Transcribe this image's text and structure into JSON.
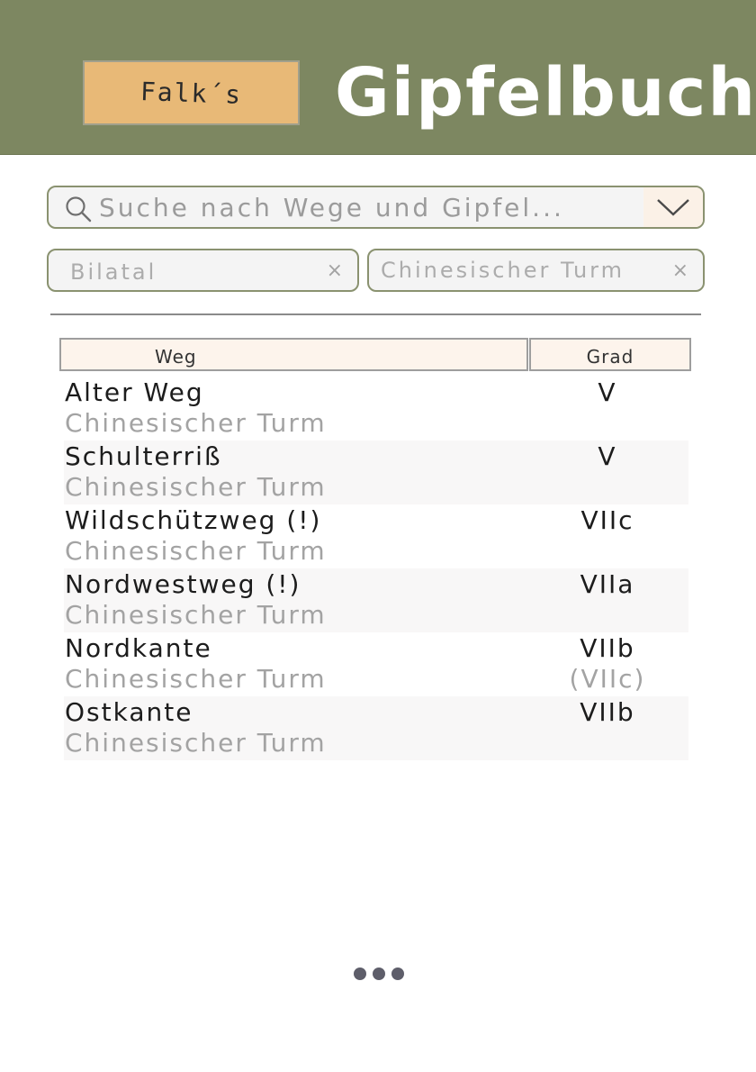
{
  "header": {
    "logo_text": "Falk´s",
    "title": "Gipfelbuch",
    "colors": {
      "background": "#7d8761",
      "badge": "#e8b977"
    }
  },
  "search": {
    "placeholder": "Suche nach Wege und Gipfel...",
    "value": "",
    "icon": "search-icon",
    "dropdown_icon": "chevron-down-icon"
  },
  "filters": [
    {
      "label": "Bilatal",
      "close": "×"
    },
    {
      "label": "Chinesischer Turm",
      "close": "×"
    }
  ],
  "table": {
    "headers": {
      "route": "Weg",
      "grade": "Grad"
    },
    "rows": [
      {
        "name": "Alter Weg",
        "peak": "Chinesischer Turm",
        "grade": "V",
        "grade_alt": ""
      },
      {
        "name": "Schulterriß",
        "peak": "Chinesischer Turm",
        "grade": "V",
        "grade_alt": ""
      },
      {
        "name": "Wildschützweg (!)",
        "peak": "Chinesischer Turm",
        "grade": "VIIc",
        "grade_alt": ""
      },
      {
        "name": "Nordwestweg (!)",
        "peak": "Chinesischer Turm",
        "grade": "VIIa",
        "grade_alt": ""
      },
      {
        "name": "Nordkante",
        "peak": "Chinesischer Turm",
        "grade": "VIIb",
        "grade_alt": "(VIIc)"
      },
      {
        "name": "Ostkante",
        "peak": "Chinesischer Turm",
        "grade": "VIIb",
        "grade_alt": ""
      }
    ]
  },
  "more_icon": "more-dots-icon"
}
